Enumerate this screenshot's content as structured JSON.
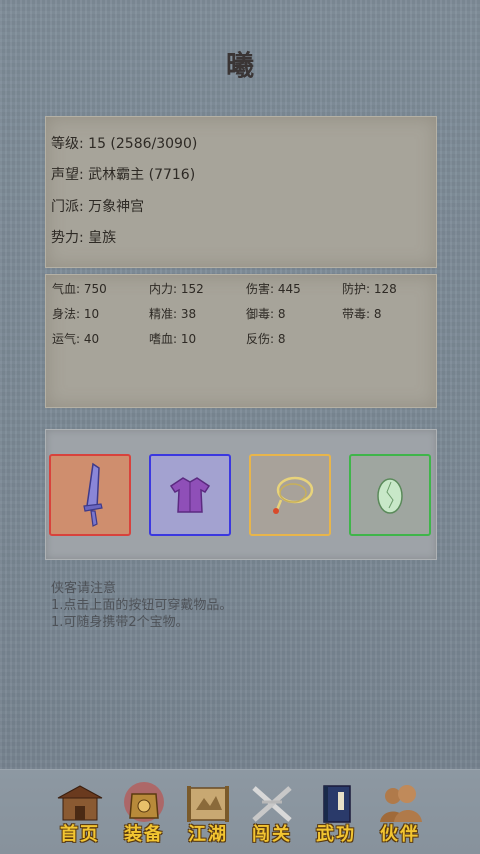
{
  "header": {
    "title": "曦"
  },
  "info": [
    "等级: 15 (2586/3090)",
    "声望: 武林霸主 (7716)",
    "门派: 万象神宫",
    "势力:  皇族"
  ],
  "stats": [
    [
      "气血: 750",
      "内力: 152",
      "伤害: 445",
      "防护: 128"
    ],
    [
      "身法: 10",
      "精准: 38",
      "御毒: 8",
      "带毒: 8"
    ],
    [
      "运气: 40",
      "嗜血: 10",
      "反伤: 8",
      ""
    ]
  ],
  "equipment": [
    {
      "icon": "sword-icon",
      "border": "#d8423c",
      "bg": "#cf8e6e"
    },
    {
      "icon": "robe-icon",
      "border": "#3b38e0",
      "bg": "#a3a2d0"
    },
    {
      "icon": "necklace-icon",
      "border": "#e8b54a",
      "bg": "#a8a29a"
    },
    {
      "icon": "jade-icon",
      "border": "#3fb54a",
      "bg": "#9fa6a0"
    }
  ],
  "notice": {
    "heading": "侠客请注意",
    "line1": "1.点击上面的按钮可穿戴物品。",
    "line2": "1.可随身携带2个宝物。"
  },
  "nav": [
    {
      "label": "首页",
      "icon": "home-icon"
    },
    {
      "label": "装备",
      "icon": "equipment-icon"
    },
    {
      "label": "江湖",
      "icon": "map-scroll-icon"
    },
    {
      "label": "闯关",
      "icon": "challenge-icon"
    },
    {
      "label": "武功",
      "icon": "martial-book-icon"
    },
    {
      "label": "伙伴",
      "icon": "partners-icon"
    }
  ]
}
